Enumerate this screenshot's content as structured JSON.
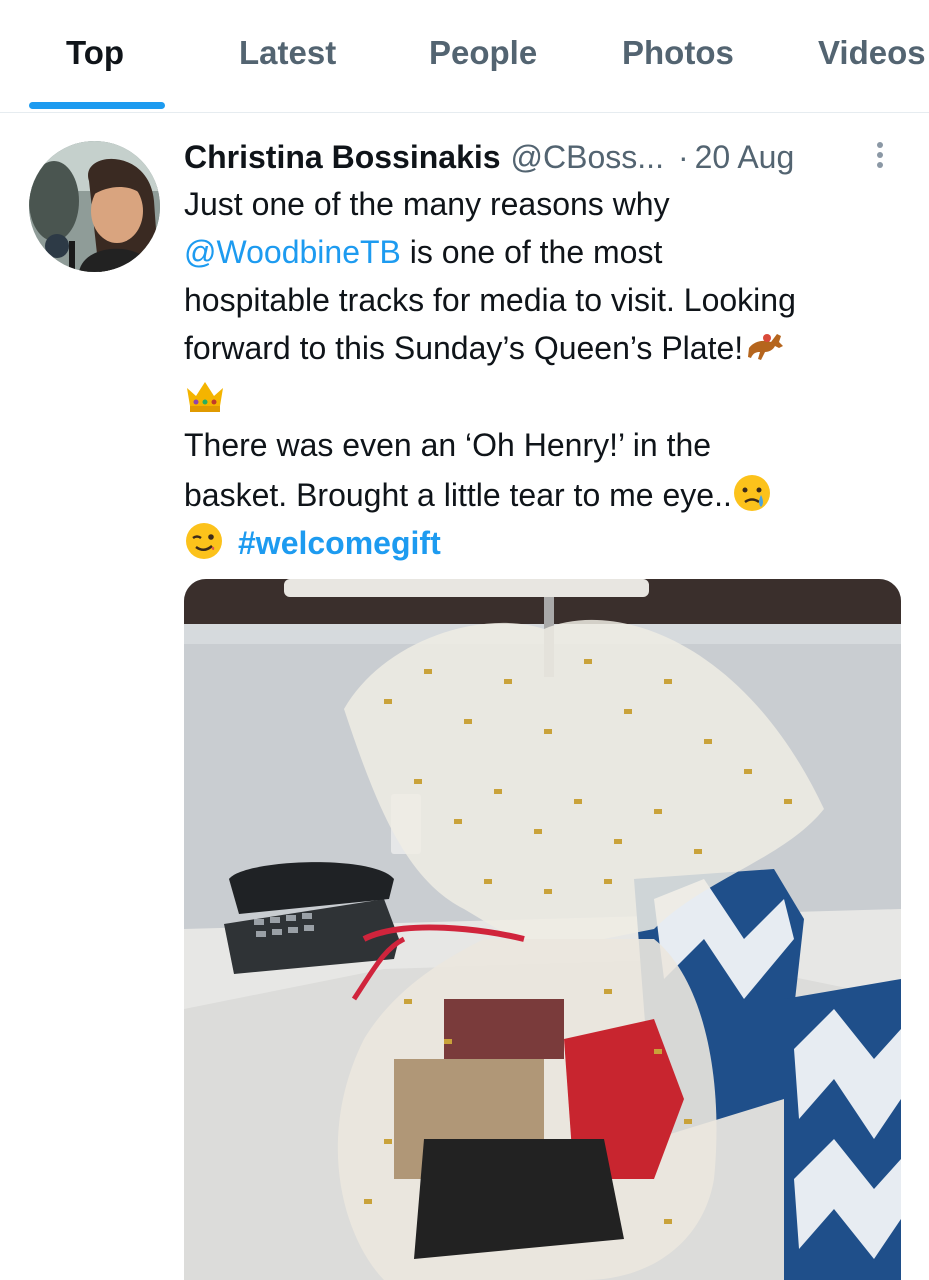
{
  "tabs": [
    {
      "label": "Top",
      "active": true
    },
    {
      "label": "Latest",
      "active": false
    },
    {
      "label": "People",
      "active": false
    },
    {
      "label": "Photos",
      "active": false
    },
    {
      "label": "Videos",
      "active": false
    }
  ],
  "tweet": {
    "author_name": "Christina Bossinakis",
    "author_handle": "@CBoss...",
    "separator": "·",
    "date": "20 Aug",
    "lines": {
      "l1": "Just one of the many reasons why",
      "l2_mention": "@WoodbineTB",
      "l2_rest": " is one of the most",
      "l3": "hospitable tracks for media to visit. Looking",
      "l4": "forward to this Sunday’s Queen’s Plate!",
      "l5": "There was even an ‘Oh Henry!’ in the",
      "l6": "basket. Brought a little tear to me eye..",
      "hashtag": "#welcomegift"
    },
    "emojis": [
      "horse-racing",
      "crown",
      "crying-face",
      "winking-face"
    ],
    "media_alt": "gift basket wrapped in cellophane"
  },
  "colors": {
    "accent": "#1d9bf0",
    "text": "#0f1419",
    "muted": "#536471"
  }
}
